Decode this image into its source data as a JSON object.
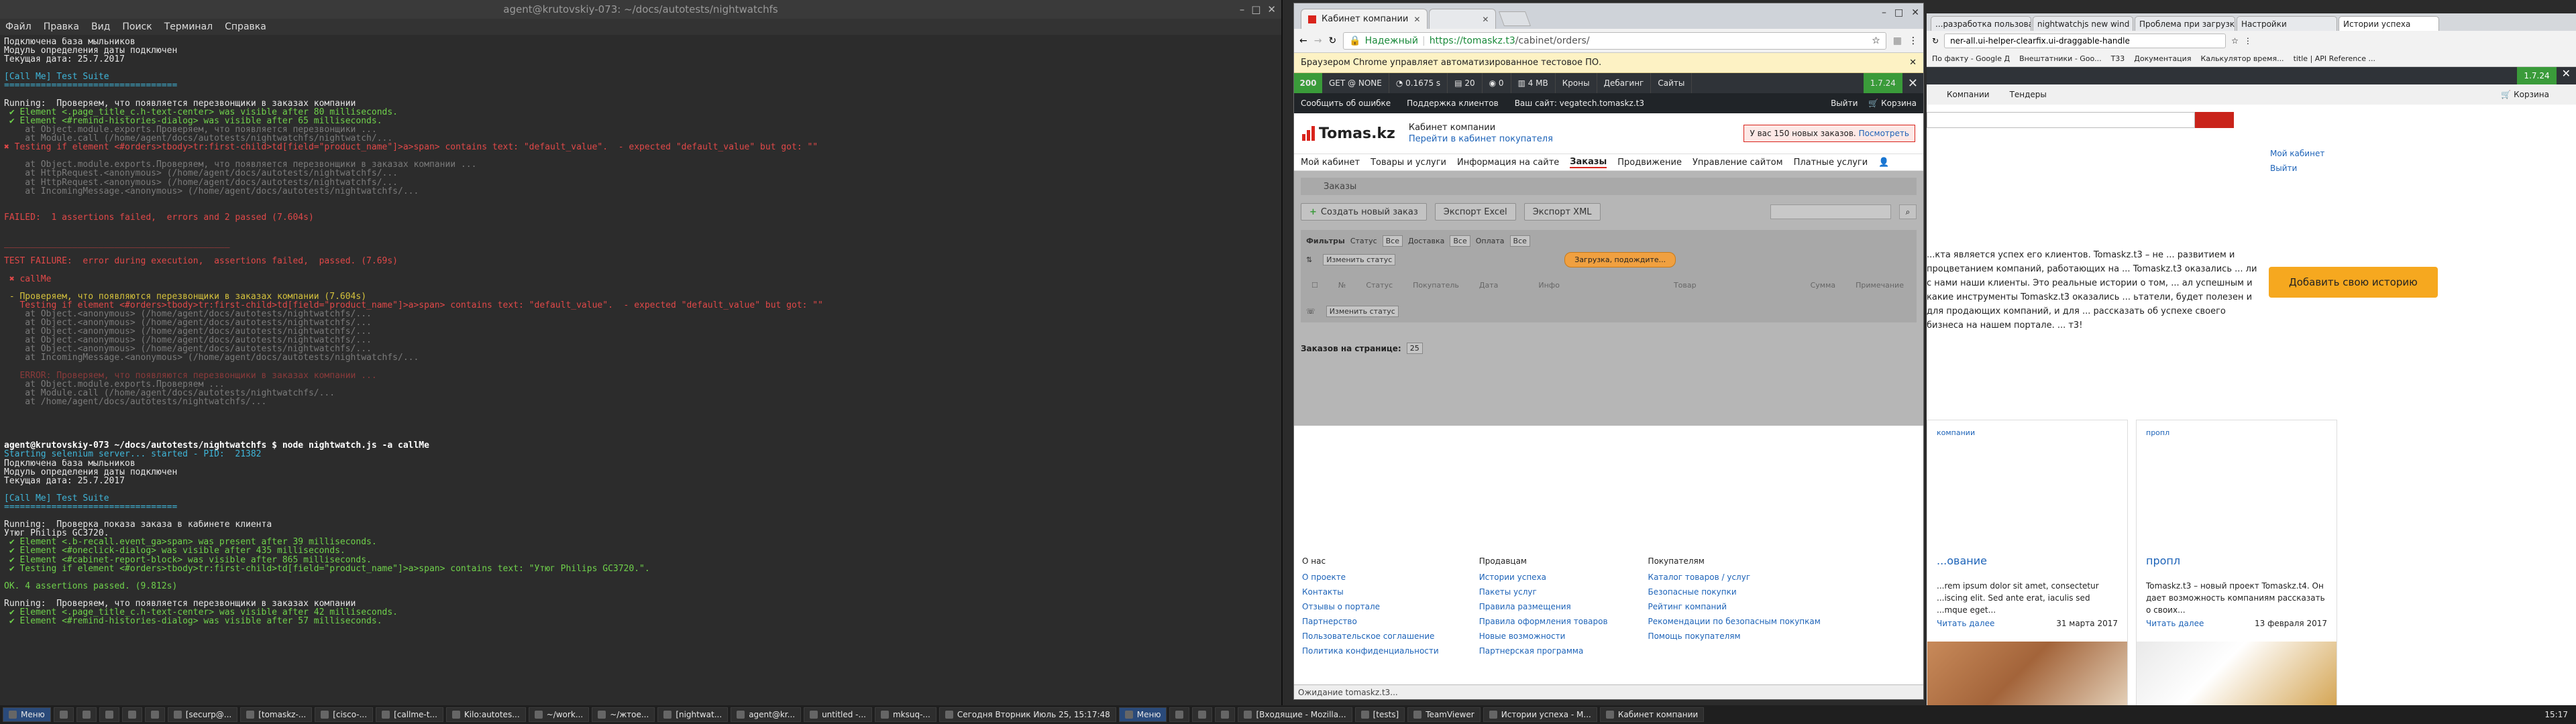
{
  "terminal": {
    "title": "agent@krutovskiy-073: ~/docs/autotests/nightwatchfs",
    "menu": [
      "Файл",
      "Правка",
      "Вид",
      "Поиск",
      "Терминал",
      "Справка"
    ],
    "lines": [
      {
        "t": "Подключена база мыльников",
        "c": "c-white"
      },
      {
        "t": "Модуль определения даты подключен",
        "c": "c-white"
      },
      {
        "t": "Текущая дата: 25.7.2017",
        "c": "c-white"
      },
      {
        "t": "",
        "c": "c-white"
      },
      {
        "t": "[Call Me] Test Suite",
        "c": "c-cyan"
      },
      {
        "t": "=================================",
        "c": "c-cyan"
      },
      {
        "t": "",
        "c": "c-white"
      },
      {
        "t": "Running:  Проверяем, что появляется перезвонщики в заказах компании",
        "c": "c-white"
      },
      {
        "t": " ✔ Element <.page_title_c.h-text-center> was visible after 80 milliseconds.",
        "c": "c-green"
      },
      {
        "t": " ✔ Element <#remind-histories-dialog> was visible after 65 milliseconds.",
        "c": "c-green"
      },
      {
        "t": "    at Object.module.exports.Проверяем, что появляется перезвонщики ...",
        "c": "c-dim"
      },
      {
        "t": "    at Module.call (/home/agent/docs/autotests/nightwatchfs/nightwatch/...",
        "c": "c-dim"
      },
      {
        "t": "✖ Testing if element <#orders>tbody>tr:first-child>td[field=\"product_name\"]>a>span> contains text: \"default_value\".  - expected \"default_value\" but got: \"\"",
        "c": "c-red"
      },
      {
        "t": "",
        "c": "c-white"
      },
      {
        "t": "    at Object.module.exports.Проверяем, что появляется перезвонщики в заказах компании ...",
        "c": "c-dim"
      },
      {
        "t": "    at HttpRequest.<anonymous> (/home/agent/docs/autotests/nightwatchfs/...",
        "c": "c-dim"
      },
      {
        "t": "    at HttpRequest.<anonymous> (/home/agent/docs/autotests/nightwatchfs/...",
        "c": "c-dim"
      },
      {
        "t": "    at IncomingMessage.<anonymous> (/home/agent/docs/autotests/nightwatchfs/...",
        "c": "c-dim"
      },
      {
        "t": "",
        "c": "c-white"
      },
      {
        "t": "",
        "c": "c-white"
      },
      {
        "t": "FAILED:  1 assertions failed,  errors and 2 passed (7.604s)",
        "c": "c-red"
      },
      {
        "t": "",
        "c": "c-white"
      },
      {
        "t": "",
        "c": "c-white"
      },
      {
        "t": "___________________________________________",
        "c": "c-red"
      },
      {
        "t": "",
        "c": "c-white"
      },
      {
        "t": "TEST FAILURE:  error during execution,  assertions failed,  passed. (7.69s)",
        "c": "c-red"
      },
      {
        "t": "",
        "c": "c-white"
      },
      {
        "t": " ✖ callMe",
        "c": "c-red"
      },
      {
        "t": "",
        "c": "c-white"
      },
      {
        "t": " - Проверяем, что появляются перезвонщики в заказах компании (7.604s)",
        "c": "c-yellow"
      },
      {
        "t": "   Testing if element <#orders>tbody>tr:first-child>td[field=\"product_name\"]>a>span> contains text: \"default_value\".  - expected \"default_value\" but got: \"\"",
        "c": "c-red"
      },
      {
        "t": "    at Object.<anonymous> (/home/agent/docs/autotests/nightwatchfs/...",
        "c": "c-dim"
      },
      {
        "t": "    at Object.<anonymous> (/home/agent/docs/autotests/nightwatchfs/...",
        "c": "c-dim"
      },
      {
        "t": "    at Object.<anonymous> (/home/agent/docs/autotests/nightwatchfs/...",
        "c": "c-dim"
      },
      {
        "t": "    at Object.<anonymous> (/home/agent/docs/autotests/nightwatchfs/...",
        "c": "c-dim"
      },
      {
        "t": "    at Object.<anonymous> (/home/agent/docs/autotests/nightwatchfs/...",
        "c": "c-dim"
      },
      {
        "t": "    at IncomingMessage.<anonymous> (/home/agent/docs/autotests/nightwatchfs/...",
        "c": "c-dim"
      },
      {
        "t": "",
        "c": "c-white"
      },
      {
        "t": "   ERROR: Проверяем, что появляются перезвонщики в заказах компании ...",
        "c": "c-dimred"
      },
      {
        "t": "    at Object.module.exports.Проверяем ...",
        "c": "c-dim"
      },
      {
        "t": "    at Module.call (/home/agent/docs/autotests/nightwatchfs/...",
        "c": "c-dim"
      },
      {
        "t": "    at /home/agent/docs/autotests/nightwatchfs/...",
        "c": "c-dim"
      },
      {
        "t": "",
        "c": "c-white"
      },
      {
        "t": "",
        "c": "c-white"
      },
      {
        "t": "",
        "c": "c-white"
      },
      {
        "t": "",
        "c": "c-white"
      },
      {
        "t": "agent@krutovskiy-073 ~/docs/autotests/nightwatchfs $ node nightwatch.js -a callMe",
        "c": "c-bold"
      },
      {
        "t": "Starting selenium server... started - PID:  21382",
        "c": "c-cyan"
      },
      {
        "t": "Подключена база мыльников",
        "c": "c-white"
      },
      {
        "t": "Модуль определения даты подключен",
        "c": "c-white"
      },
      {
        "t": "Текущая дата: 25.7.2017",
        "c": "c-white"
      },
      {
        "t": "",
        "c": "c-white"
      },
      {
        "t": "[Call Me] Test Suite",
        "c": "c-cyan"
      },
      {
        "t": "=================================",
        "c": "c-cyan"
      },
      {
        "t": "",
        "c": "c-white"
      },
      {
        "t": "Running:  Проверка показа заказа в кабинете клиента",
        "c": "c-white"
      },
      {
        "t": "Утюг Philips GC3720.",
        "c": "c-white"
      },
      {
        "t": " ✔ Element <.b-recall.event_ga>span> was present after 39 milliseconds.",
        "c": "c-green"
      },
      {
        "t": " ✔ Element <#oneclick-dialog> was visible after 435 milliseconds.",
        "c": "c-green"
      },
      {
        "t": " ✔ Element <#cabinet-report-block> was visible after 865 milliseconds.",
        "c": "c-green"
      },
      {
        "t": " ✔ Testing if element <#orders>tbody>tr:first-child>td[field=\"product_name\"]>a>span> contains text: \"Утюг Philips GC3720.\".",
        "c": "c-green"
      },
      {
        "t": "",
        "c": "c-white"
      },
      {
        "t": "OK. 4 assertions passed. (9.812s)",
        "c": "c-green"
      },
      {
        "t": "",
        "c": "c-white"
      },
      {
        "t": "Running:  Проверяем, что появляется перезвонщики в заказах компании",
        "c": "c-white"
      },
      {
        "t": " ✔ Element <.page_title_c.h-text-center> was visible after 42 milliseconds.",
        "c": "c-green"
      },
      {
        "t": " ✔ Element <#remind-histories-dialog> was visible after 57 milliseconds.",
        "c": "c-green"
      }
    ]
  },
  "chrome1": {
    "tabs": [
      {
        "label": "Кабинет компании"
      },
      {
        "label": ""
      }
    ],
    "url_secure": "Надежный",
    "url_host": "https://tomaskz.t3",
    "url_path": "/cabinet/orders/",
    "infobar": "Браузером Chrome управляет автоматизированное тестовое ПО.",
    "devbar": {
      "code": "200",
      "get": "GET @ NONE",
      "time": "0.1675 s",
      "queries": "20",
      "dots": "0",
      "mem": "4 MB",
      "routes": "Кроны",
      "debug": "Дебагинг",
      "sites": "Сайты",
      "version": "1.7.24"
    },
    "topnav": {
      "report": "Сообщить об ошибке",
      "support": "Поддержка клиентов",
      "site": "Ваш сайт: vegatech.tomaskz.t3",
      "logout": "Выйти",
      "cart": "Корзина"
    },
    "logo": "Tomas.kz",
    "cabinet_title": "Кабинет компании",
    "cabinet_link": "Перейти в кабинет покупателя",
    "notice_text": "У вас 150 новых заказов.",
    "notice_link": "Посмотреть",
    "menu": [
      "Мой кабинет",
      "Товары и услуги",
      "Информация на сайте",
      "Заказы",
      "Продвижение",
      "Управление сайтом",
      "Платные услуги"
    ],
    "crumb": "Заказы",
    "buttons": {
      "create": "Создать новый заказ",
      "excel": "Экспорт Excel",
      "xml": "Экспорт XML"
    },
    "filters": {
      "label": "Фильтры",
      "status": "Статус",
      "delivery": "Доставка",
      "payment": "Оплата",
      "all": "Все",
      "change_status": "Изменить статус",
      "loading": "Загрузка, подождите..."
    },
    "table_headers": [
      "№",
      "Статус",
      "Покупатель",
      "Дата",
      "Инфо",
      "Товар",
      "Сумма",
      "Примечание"
    ],
    "per_page_label": "Заказов на странице:",
    "per_page_value": "25",
    "footer": [
      {
        "title": "О нас",
        "links": [
          "О проекте",
          "Контакты",
          "Отзывы о портале",
          "Партнерство",
          "Пользовательское соглашение",
          "Политика конфиденциальности"
        ]
      },
      {
        "title": "Продавцам",
        "links": [
          "Истории успеха",
          "Пакеты услуг",
          "Правила размещения",
          "Правила оформления товаров",
          "Новые возможности",
          "Партнерская программа"
        ]
      },
      {
        "title": "Покупателям",
        "links": [
          "Каталог товаров / услуг",
          "Безопасные покупки",
          "Рейтинг компаний",
          "Рекомендации по безопасным покупкам",
          "Помощь покупателям"
        ]
      }
    ],
    "status": "Ожидание tomaskz.t3..."
  },
  "chrome2": {
    "tabs": [
      "...разработка пользоват",
      "nightwatchjs new wind",
      "Проблема при загрузк",
      "Настройки",
      "Истории успеха"
    ],
    "url": "ner-all.ui-helper-clearfix.ui-draggable-handle",
    "bookmarks": [
      "По факту - Google Д",
      "Внештатники - Goo...",
      "T33",
      "Документация",
      "Калькулятор время...",
      "title | API Reference ..."
    ],
    "version": "1.7.24",
    "nav": [
      "Компании",
      "Тендеры"
    ],
    "cart": "Корзина",
    "side_links": [
      "Мой кабинет",
      "Выйти"
    ],
    "para": "...кта является успех его клиентов. Tomaskz.t3 – не ... развитием и процветанием компаний, работающих на ... Tomaskz.t3 оказались ... ли с нами наши клиенты. Это реальные истории о том, ... ал успешным и какие инструменты Tomaskz.t3 оказались ... ьтатели, будет полезен и для продающих компаний, и для ... рассказать об успехе своего бизнеса на нашем портале. ... т3!",
    "add_story": "Добавить свою историю",
    "cards": [
      {
        "tag": "компании",
        "title": "...ование",
        "text": "...rem ipsum dolor sit amet, consectetur ...iscing elit. Sed ante erat, iaculis sed ...mque eget...",
        "more": "Читать далее",
        "date": "31 марта 2017"
      },
      {
        "tag": "пропл",
        "title": "пропл",
        "text": "Tomaskz.t3 – новый проект Tomaskz.t4. Он дает возможность компаниям рассказать о своих...",
        "more": "Читать далее",
        "date": "13 февраля 2017"
      }
    ]
  },
  "taskbar": {
    "items": [
      "Меню",
      "",
      "",
      "",
      "",
      "",
      "[securp@...",
      "[tomaskz-...",
      "[cisco-...",
      "[callme-t...",
      "Kilo:autotes...",
      "~/work...",
      "~/жтое...",
      "[nightwat...",
      "agent@kr...",
      "untitled -...",
      "mksuq-...",
      "Сегодня Вторник Июль 25, 15:17:48",
      "Меню",
      "",
      "",
      "",
      "[Входящие - Mozilla...",
      "[tests]",
      "TeamViewer",
      "Истории успеха - M...",
      "Кабинет компании"
    ],
    "clock": "15:17"
  }
}
